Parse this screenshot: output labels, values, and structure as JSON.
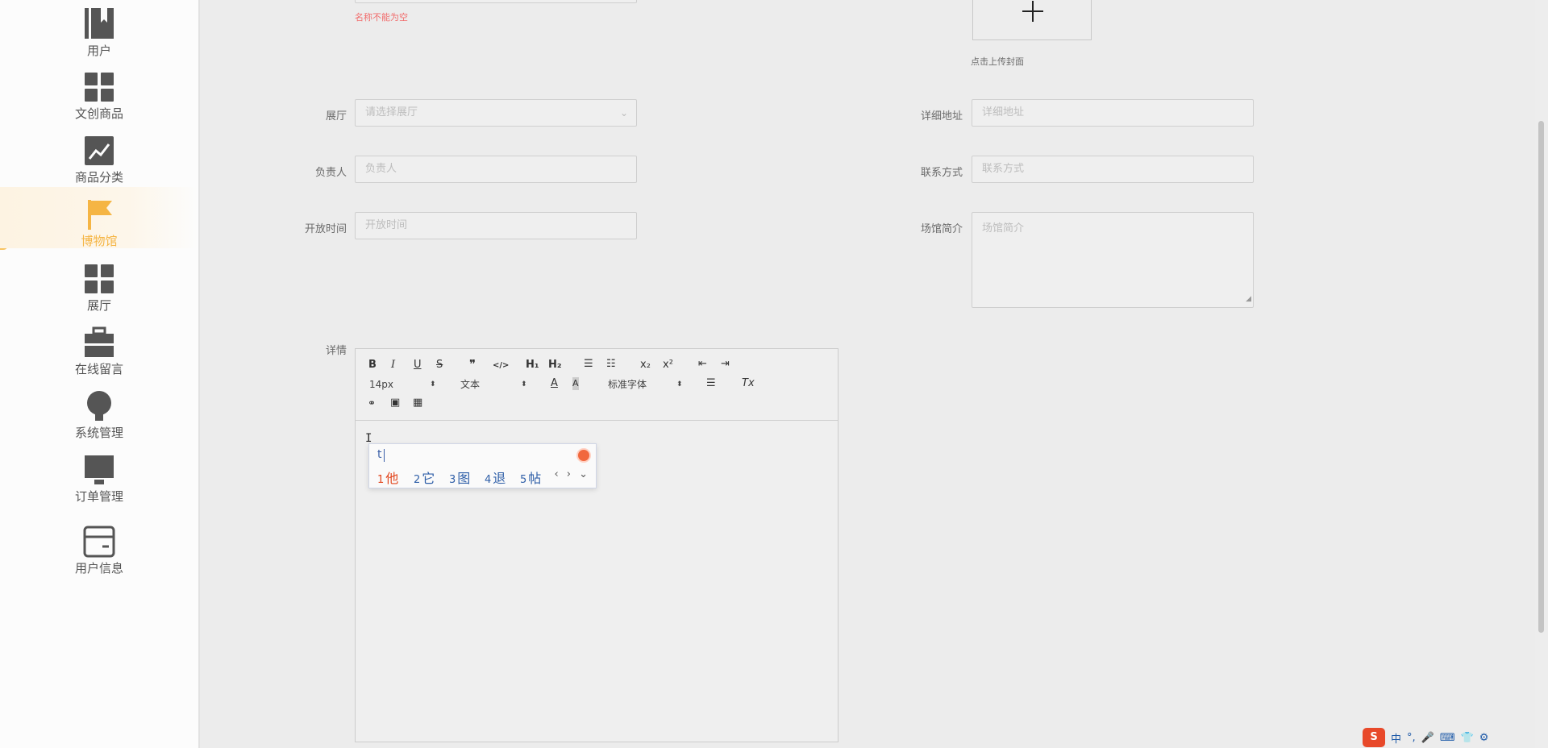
{
  "sidebar": {
    "items": [
      {
        "label": "用户",
        "icon": "bookmark-icon"
      },
      {
        "label": "文创商品",
        "icon": "grid-icon"
      },
      {
        "label": "商品分类",
        "icon": "chart-line-icon"
      },
      {
        "label": "博物馆",
        "icon": "flag-icon",
        "active": true
      },
      {
        "label": "展厅",
        "icon": "grid-icon"
      },
      {
        "label": "在线留言",
        "icon": "briefcase-icon"
      },
      {
        "label": "系统管理",
        "icon": "lightbulb-icon"
      },
      {
        "label": "订单管理",
        "icon": "monitor-icon"
      },
      {
        "label": "用户信息",
        "icon": "card-icon"
      }
    ],
    "active_color": "#f5b544"
  },
  "form": {
    "name_error": "名称不能为空",
    "cover": {
      "hint": "点击上传封面"
    },
    "hall": {
      "label": "展厅",
      "placeholder": "请选择展厅"
    },
    "address": {
      "label": "详细地址",
      "placeholder": "详细地址"
    },
    "manager": {
      "label": "负责人",
      "placeholder": "负责人"
    },
    "contact": {
      "label": "联系方式",
      "placeholder": "联系方式"
    },
    "open_time": {
      "label": "开放时间",
      "placeholder": "开放时间"
    },
    "intro": {
      "label": "场馆简介",
      "placeholder": "场馆简介"
    },
    "details": {
      "label": "详情"
    }
  },
  "editor": {
    "toolbar": {
      "bold": "B",
      "italic": "I",
      "underline": "U",
      "strike": "S",
      "quote": "❞",
      "code": "</>",
      "h1": "H₁",
      "h2": "H₂",
      "ordered_list": "☰",
      "bullet_list": "☷",
      "subscript": "x₂",
      "superscript": "x²",
      "indent_decrease": "⇤",
      "indent_increase": "⇥",
      "size": "14px",
      "header": "文本",
      "font": "标准字体",
      "align": "☰",
      "clean": "Tx",
      "link": "🔗",
      "image": "▣",
      "video": "▦"
    }
  },
  "ime": {
    "typed": "t",
    "candidates": [
      {
        "num": "1",
        "text": "他"
      },
      {
        "num": "2",
        "text": "它"
      },
      {
        "num": "3",
        "text": "图"
      },
      {
        "num": "4",
        "text": "退"
      },
      {
        "num": "5",
        "text": "帖"
      }
    ],
    "nav": "‹ › ⌄"
  },
  "tray": {
    "sogou": "S",
    "lang": "中",
    "punct": "°,",
    "mic": "🎤",
    "keyboard": "⌨",
    "skin": "👕",
    "tools": "⚙"
  }
}
